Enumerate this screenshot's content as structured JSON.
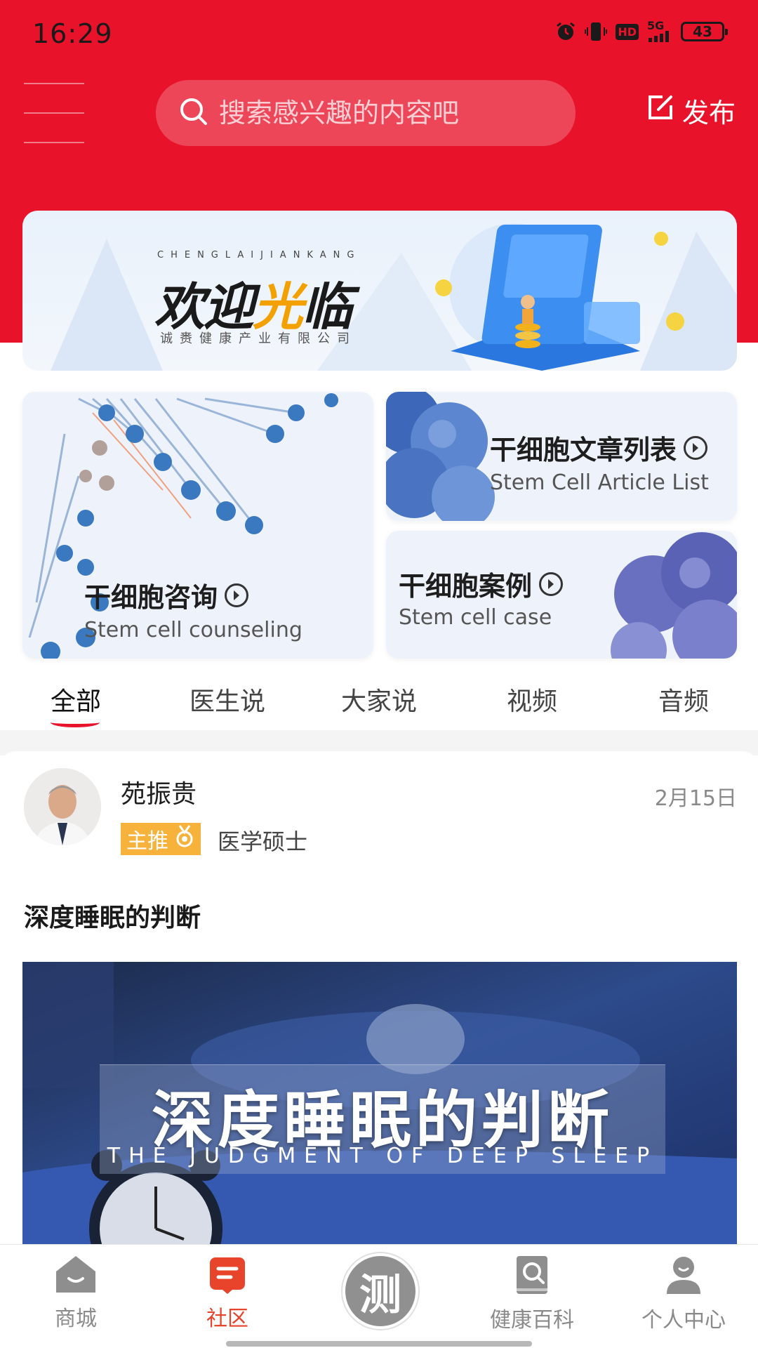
{
  "status_bar": {
    "time": "16:29",
    "network": "5G",
    "hd": "HD",
    "battery": "43"
  },
  "header": {
    "search_placeholder": "搜索感兴趣的内容吧",
    "publish_label": "发布"
  },
  "banner": {
    "subtitle_en": "CHENGLAIJIANKANG",
    "title_part1": "欢迎",
    "title_part2": "光",
    "title_part3": "临",
    "company": "诚赉健康产业有限公司"
  },
  "cards": [
    {
      "title": "干细胞咨询",
      "subtitle": "Stem cell counseling"
    },
    {
      "title": "干细胞文章列表",
      "subtitle": "Stem Cell Article List"
    },
    {
      "title": "干细胞案例",
      "subtitle": "Stem cell case"
    }
  ],
  "tabs": [
    {
      "label": "全部",
      "active": true
    },
    {
      "label": "医生说",
      "active": false
    },
    {
      "label": "大家说",
      "active": false
    },
    {
      "label": "视频",
      "active": false
    },
    {
      "label": "音频",
      "active": false
    }
  ],
  "post": {
    "author": "苑振贵",
    "date": "2月15日",
    "badge": "主推",
    "author_title": "医学硕士",
    "title": "深度睡眠的判断",
    "image_title": "深度睡眠的判断",
    "image_subtitle": "THE JUDGMENT OF DEEP SLEEP"
  },
  "bottom_nav": [
    {
      "label": "商城",
      "icon": "home-icon",
      "active": false
    },
    {
      "label": "社区",
      "icon": "community-icon",
      "active": true
    },
    {
      "label": "测",
      "icon": "test-icon",
      "active": false
    },
    {
      "label": "健康百科",
      "icon": "encyclopedia-icon",
      "active": false
    },
    {
      "label": "个人中心",
      "icon": "profile-icon",
      "active": false
    }
  ],
  "colors": {
    "brand_red": "#e8132b",
    "badge_orange": "#f7b23b",
    "active_nav": "#e8432b"
  }
}
